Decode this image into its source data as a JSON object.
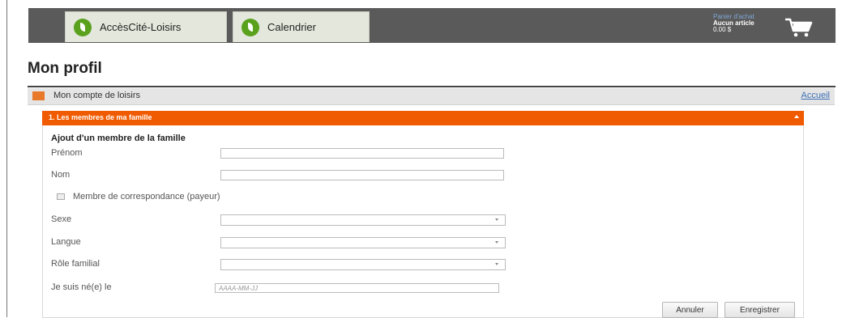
{
  "nav": {
    "tabs": [
      {
        "label": "AccèsCité-Loisirs",
        "icon": "leaf-icon"
      },
      {
        "label": "Calendrier",
        "icon": "leaf-icon"
      }
    ],
    "cart": {
      "title": "Panier d'achat",
      "count": "Aucun article",
      "total": "0.00 $",
      "icon": "shopping-cart-icon"
    }
  },
  "page": {
    "title": "Mon profil"
  },
  "section": {
    "title": "Mon compte de loisirs",
    "home_link": "Accueil",
    "accent_color": "#e8792a"
  },
  "panel": {
    "title": "1. Les membres de ma famille",
    "header_color": "#f05a00",
    "sub_heading": "Ajout d'un membre de la famille",
    "fields": {
      "first_name": {
        "label": "Prénom",
        "value": ""
      },
      "last_name": {
        "label": "Nom",
        "value": ""
      },
      "correspondence": {
        "label": "Membre de correspondance (payeur)",
        "checked": false
      },
      "sex": {
        "label": "Sexe",
        "value": ""
      },
      "language": {
        "label": "Langue",
        "value": ""
      },
      "family_role": {
        "label": "Rôle familial",
        "value": ""
      },
      "birth_date": {
        "label": "Je suis né(e) le",
        "placeholder": "AAAA-MM-JJ",
        "value": ""
      }
    },
    "buttons": {
      "cancel": "Annuler",
      "save": "Enregistrer"
    }
  }
}
